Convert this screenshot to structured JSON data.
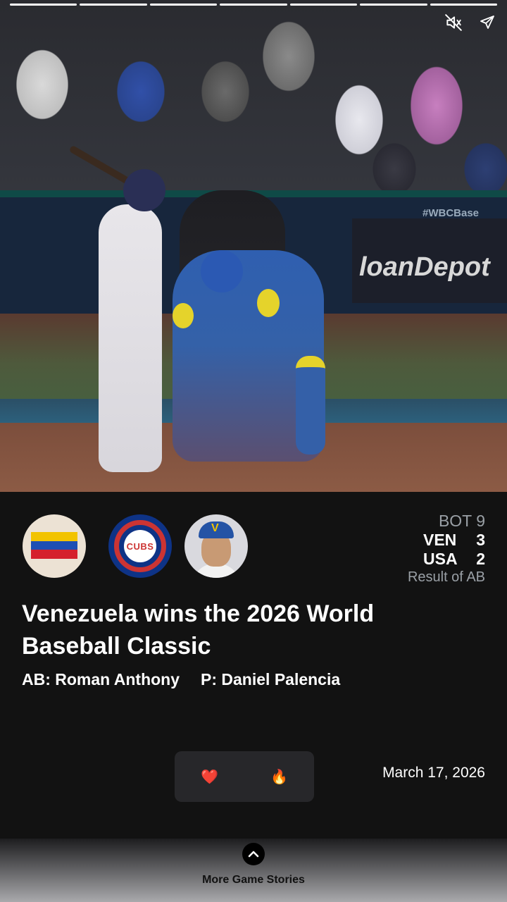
{
  "story": {
    "progress_total": 7,
    "progress_completed": 7
  },
  "video": {
    "mute_icon": "speaker-muted-icon",
    "share_icon": "paper-plane-share-icon",
    "sign_text": "loanDepot"
  },
  "logos": {
    "team1": "venezuela-flag-logo",
    "team2": "chicago-cubs-logo",
    "team2_text": "CUBS",
    "player": "player-headshot",
    "player_cap_letter": "V"
  },
  "scoreboard": {
    "inning": "BOT 9",
    "rows": [
      {
        "team": "VEN",
        "runs": "3"
      },
      {
        "team": "USA",
        "runs": "2"
      }
    ],
    "result": "Result of AB"
  },
  "headline": "Venezuela wins the 2026 World Baseball Classic",
  "matchup": {
    "batter": "AB: Roman Anthony",
    "pitcher": "P: Daniel Palencia"
  },
  "reactions": [
    {
      "emoji": "❤️",
      "icon": "heart-icon"
    },
    {
      "emoji": "🔥",
      "icon": "fire-icon"
    }
  ],
  "date": "March 17, 2026",
  "footer": {
    "label": "More Game Stories",
    "icon": "chevron-up-icon"
  },
  "colors": {
    "background": "#121212",
    "reaction_bg": "#27272a",
    "muted_text": "#9aa0a6",
    "cubs_blue": "#0e3386",
    "cubs_red": "#cc3433"
  }
}
